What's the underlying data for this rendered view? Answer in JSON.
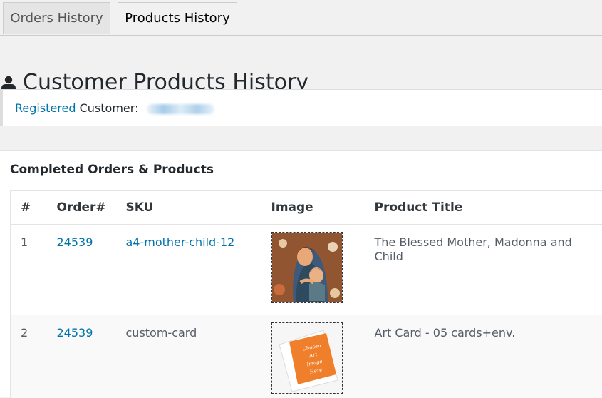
{
  "tabs": [
    {
      "label": "Orders History",
      "active": false
    },
    {
      "label": "Products History",
      "active": true
    }
  ],
  "page": {
    "title": "Customer Products History",
    "icon": "user-icon"
  },
  "customer": {
    "link_label": "Registered",
    "label": "Customer:"
  },
  "panel": {
    "heading": "Completed Orders & Products"
  },
  "table": {
    "headers": [
      "#",
      "Order#",
      "SKU",
      "Image",
      "Product Title"
    ],
    "rows": [
      {
        "num": "1",
        "order": "24539",
        "sku": "a4-mother-child-12",
        "sku_is_link": true,
        "title": "The Blessed Mother, Madonna and Child"
      },
      {
        "num": "2",
        "order": "24539",
        "sku": "custom-card",
        "sku_is_link": false,
        "title": "Art Card - 05 cards+env.",
        "image_text": "Chosen Art Image Here"
      }
    ]
  },
  "colors": {
    "link": "#0073aa",
    "background": "#f1f1f1",
    "panel": "#ffffff",
    "card_orange": "#f07f2c"
  }
}
